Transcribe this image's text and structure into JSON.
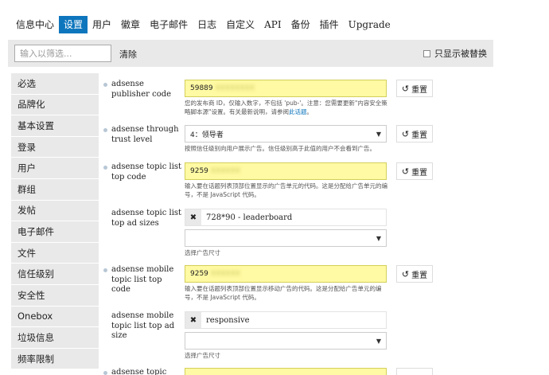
{
  "nav": {
    "tabs": [
      {
        "label": "信息中心"
      },
      {
        "label": "设置",
        "active": true
      },
      {
        "label": "用户"
      },
      {
        "label": "徽章"
      },
      {
        "label": "电子邮件"
      },
      {
        "label": "日志"
      },
      {
        "label": "自定义"
      },
      {
        "label": "API"
      },
      {
        "label": "备份"
      },
      {
        "label": "插件"
      },
      {
        "label": "Upgrade"
      }
    ]
  },
  "filter": {
    "placeholder": "输入以筛选...",
    "clear_label": "清除",
    "only_overridden_label": "只显示被替换"
  },
  "sidebar": {
    "items": [
      {
        "label": "必选"
      },
      {
        "label": "品牌化"
      },
      {
        "label": "基本设置"
      },
      {
        "label": "登录"
      },
      {
        "label": "用户"
      },
      {
        "label": "群组"
      },
      {
        "label": "发帖"
      },
      {
        "label": "电子邮件"
      },
      {
        "label": "文件"
      },
      {
        "label": "信任级别"
      },
      {
        "label": "安全性"
      },
      {
        "label": "Onebox"
      },
      {
        "label": "垃圾信息"
      },
      {
        "label": "频率限制"
      }
    ]
  },
  "settings": {
    "reset_label": "重置",
    "publisher_code": {
      "label": "adsense publisher code",
      "value_visible": "59889",
      "value_blurred": "XXXXXXXX",
      "help_prefix": "您的发布商 ID，仅输入数字，不包括 'pub-'。注意：您需要更新\"内容安全策略脚本源\"设置。有关最新说明，请参阅",
      "help_link": "此话题"
    },
    "through_trust": {
      "label": "adsense through trust level",
      "value": "4：领导者",
      "help": "按照信任级别向用户展示广告。信任级别高于此值的用户不会看到广告。"
    },
    "topic_list_top_code": {
      "label": "adsense topic list top code",
      "value_visible": "9259",
      "value_blurred": "XXXXXX",
      "help": "输入要在话题列表顶部位置显示的广告单元的代码。这是分配给广告单元的编号，不是 JavaScript 代码。"
    },
    "topic_list_top_sizes": {
      "label": "adsense topic list top ad sizes",
      "item": "728*90 - leaderboard",
      "help": "选择广告尺寸"
    },
    "mobile_topic_list_top_code": {
      "label": "adsense mobile topic list top code",
      "value_visible": "9259",
      "value_blurred": "XXXXXX",
      "help": "输入要在话题列表顶部位置显示移动广告的代码。这是分配给广告单元的编号，不是 JavaScript 代码。"
    },
    "mobile_topic_list_top_sizes": {
      "label": "adsense mobile topic list top ad size",
      "item": "responsive",
      "help": "选择广告尺寸"
    },
    "topic_above": {
      "label": "adsense topic above"
    }
  },
  "colors": {
    "accent": "#0e76bd",
    "override_bg": "#fffaa3",
    "panel_bg": "#e9e9e9"
  }
}
